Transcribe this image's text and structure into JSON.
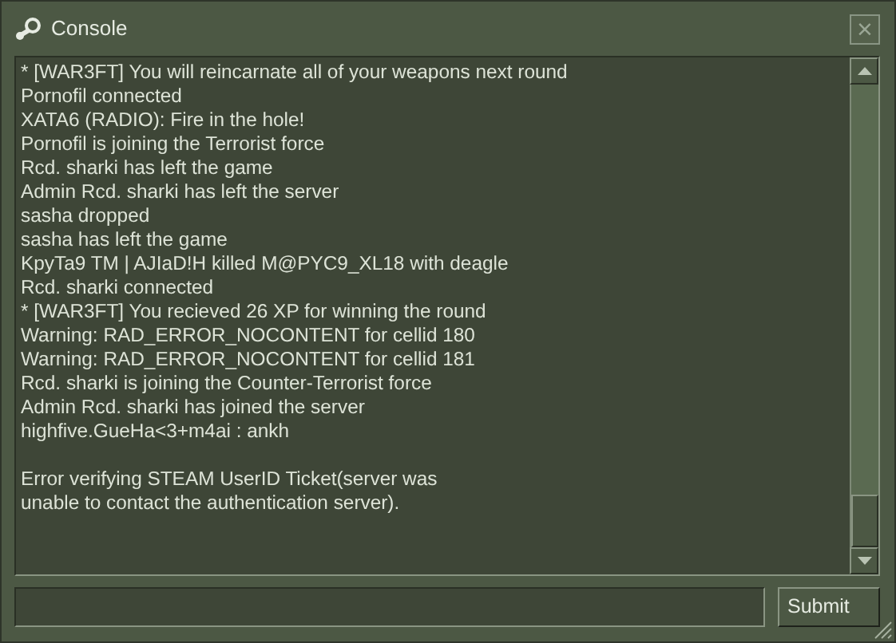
{
  "window": {
    "title": "Console",
    "close_label": "×"
  },
  "output": {
    "lines": [
      "* [WAR3FT] You will reincarnate all of your weapons next round",
      "Pornofil connected",
      "XATA6 (RADIO): Fire in the hole!",
      "Pornofil is joining the Terrorist force",
      "Rcd. sharki has left the game",
      "Admin Rcd. sharki has left the server",
      "sasha dropped",
      "sasha has left the game",
      "KpyTa9 TM | AJIaD!H killed M@PYC9_XL18 with deagle",
      "Rcd. sharki connected",
      "* [WAR3FT] You recieved 26 XP for winning the round",
      "Warning:  RAD_ERROR_NOCONTENT for cellid 180",
      "Warning:  RAD_ERROR_NOCONTENT for cellid 181",
      "Rcd. sharki is joining the Counter-Terrorist force",
      "Admin Rcd. sharki has joined the server",
      "highfive.GueHa<3+m4ai :  ankh"
    ],
    "notice_lines": [
      "Error verifying STEAM UserID Ticket(server was",
      "unable to contact the authentication server)."
    ]
  },
  "buttons": [
    "Submit"
  ]
}
